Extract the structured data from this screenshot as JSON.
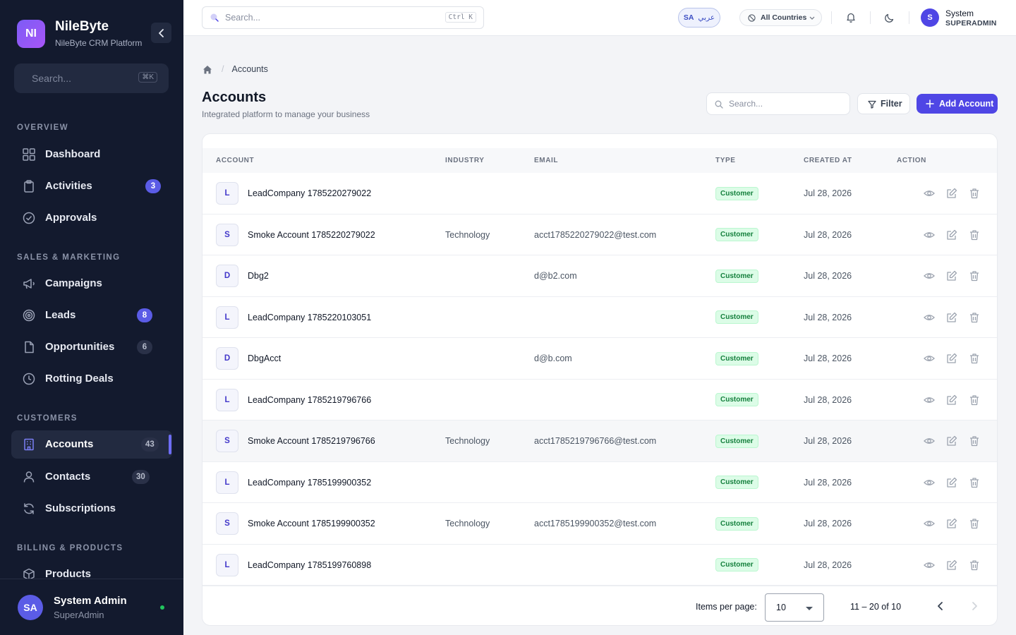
{
  "app": {
    "logo_initials": "NI",
    "name": "NileByte",
    "subtitle": "NileByte CRM Platform"
  },
  "sidebar": {
    "search_placeholder": "Search...",
    "search_shortcut": "⌘K",
    "sections": {
      "overview": "OVERVIEW",
      "sales": "SALES & MARKETING",
      "customers": "CUSTOMERS",
      "billing": "BILLING & PRODUCTS"
    },
    "items": {
      "dashboard": {
        "label": "Dashboard",
        "icon": "grid-icon"
      },
      "activities": {
        "label": "Activities",
        "badge": "3",
        "icon": "clipboard-icon"
      },
      "approvals": {
        "label": "Approvals",
        "icon": "check-circle-icon"
      },
      "campaigns": {
        "label": "Campaigns",
        "icon": "megaphone-icon"
      },
      "leads": {
        "label": "Leads",
        "badge": "8",
        "icon": "target-icon"
      },
      "opportunities": {
        "label": "Opportunities",
        "badge": "6",
        "icon": "document-icon"
      },
      "rotting": {
        "label": "Rotting Deals",
        "icon": "clock-icon"
      },
      "accounts": {
        "label": "Accounts",
        "badge": "43",
        "icon": "building-icon"
      },
      "contacts": {
        "label": "Contacts",
        "badge": "30",
        "icon": "user-icon"
      },
      "subscriptions": {
        "label": "Subscriptions",
        "icon": "refresh-icon"
      },
      "products": {
        "label": "Products",
        "icon": "box-icon"
      }
    },
    "user": {
      "initials": "SA",
      "name": "System Admin",
      "role": "SuperAdmin"
    }
  },
  "topbar": {
    "search_placeholder": "Search...",
    "search_shortcut": "Ctrl K",
    "lang_code": "SA",
    "lang_label": "عربي",
    "country": "All Countries",
    "user_initial": "S",
    "user_name": "System",
    "user_role": "SUPERADMIN"
  },
  "page": {
    "breadcrumb": "Accounts",
    "title": "Accounts",
    "subtitle": "Integrated platform to manage your business",
    "search_placeholder": "Search...",
    "filter_label": "Filter",
    "add_label": "Add Account"
  },
  "table": {
    "columns": [
      "ACCOUNT",
      "INDUSTRY",
      "EMAIL",
      "TYPE",
      "CREATED AT",
      "ACTION"
    ],
    "rows": [
      {
        "initial": "L",
        "name": "LeadCompany 1785220279022",
        "industry": "",
        "email": "",
        "type": "Customer",
        "created": "Jul 28, 2026"
      },
      {
        "initial": "S",
        "name": "Smoke Account 1785220279022",
        "industry": "Technology",
        "email": "acct1785220279022@test.com",
        "type": "Customer",
        "created": "Jul 28, 2026"
      },
      {
        "initial": "D",
        "name": "Dbg2",
        "industry": "",
        "email": "d@b2.com",
        "type": "Customer",
        "created": "Jul 28, 2026"
      },
      {
        "initial": "L",
        "name": "LeadCompany 1785220103051",
        "industry": "",
        "email": "",
        "type": "Customer",
        "created": "Jul 28, 2026"
      },
      {
        "initial": "D",
        "name": "DbgAcct",
        "industry": "",
        "email": "d@b.com",
        "type": "Customer",
        "created": "Jul 28, 2026"
      },
      {
        "initial": "L",
        "name": "LeadCompany 1785219796766",
        "industry": "",
        "email": "",
        "type": "Customer",
        "created": "Jul 28, 2026"
      },
      {
        "initial": "S",
        "name": "Smoke Account 1785219796766",
        "industry": "Technology",
        "email": "acct1785219796766@test.com",
        "type": "Customer",
        "created": "Jul 28, 2026"
      },
      {
        "initial": "L",
        "name": "LeadCompany 1785199900352",
        "industry": "",
        "email": "",
        "type": "Customer",
        "created": "Jul 28, 2026"
      },
      {
        "initial": "S",
        "name": "Smoke Account 1785199900352",
        "industry": "Technology",
        "email": "acct1785199900352@test.com",
        "type": "Customer",
        "created": "Jul 28, 2026"
      },
      {
        "initial": "L",
        "name": "LeadCompany 1785199760898",
        "industry": "",
        "email": "",
        "type": "Customer",
        "created": "Jul 28, 2026"
      }
    ]
  },
  "pagination": {
    "items_label": "Items per page:",
    "per_page": "10",
    "range": "11 – 20 of 10"
  },
  "colors": {
    "sidebar_bg": "#131a2e",
    "accent": "#4f46e5",
    "type_badge_bg": "#dcfce7",
    "type_badge_text": "#15803d"
  }
}
